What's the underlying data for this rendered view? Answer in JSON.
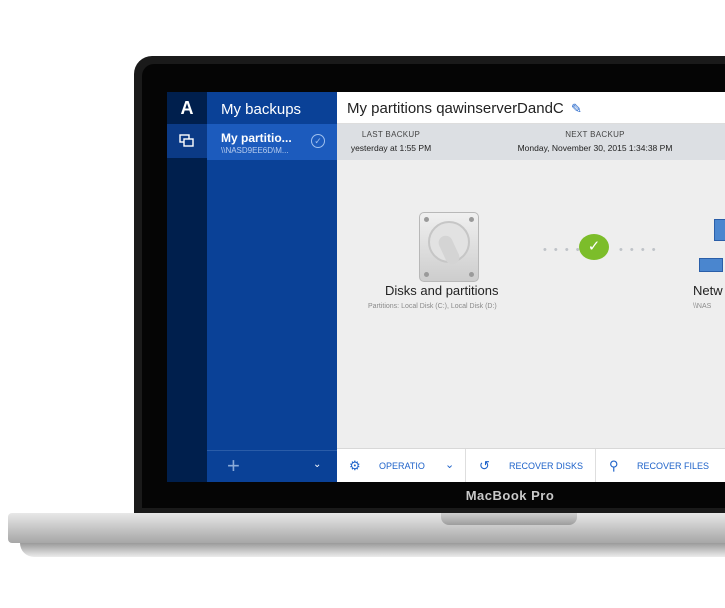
{
  "device": {
    "brand": "MacBook Pro"
  },
  "rail": {
    "logo": "A",
    "icons": [
      "backups-icon"
    ]
  },
  "sidebar": {
    "title": "My backups",
    "items": [
      {
        "title": "My partitio...",
        "subtitle": "\\\\NASD9EE6D\\M..."
      }
    ],
    "add_symbol": "+",
    "caret_symbol": "⌄"
  },
  "main": {
    "title": "My partitions qawinserverDandC",
    "info": {
      "last_backup_label": "LAST BACKUP",
      "last_backup_value": "yesterday at 1:55 PM",
      "next_backup_label": "NEXT BACKUP",
      "next_backup_value": "Monday, November 30, 2015 1:34:38 PM"
    },
    "source": {
      "name": "Disks and partitions",
      "detail": "Partitions: Local Disk (C:), Local Disk (D:)"
    },
    "destination": {
      "name": "Netw",
      "detail": "\\\\NAS"
    },
    "status_symbol": "✓",
    "dots": "• • • •"
  },
  "toolbar": {
    "operations_label": "OPERATIO",
    "recover_disks_label": "RECOVER DISKS",
    "recover_files_label": "RECOVER FILES",
    "caret_symbol": "⌄"
  },
  "colors": {
    "rail": "#001f4d",
    "sidebar": "#0a4197",
    "sidebar_selected": "#1c5bbd",
    "accent": "#1e62c9",
    "success": "#7cbd2a"
  }
}
